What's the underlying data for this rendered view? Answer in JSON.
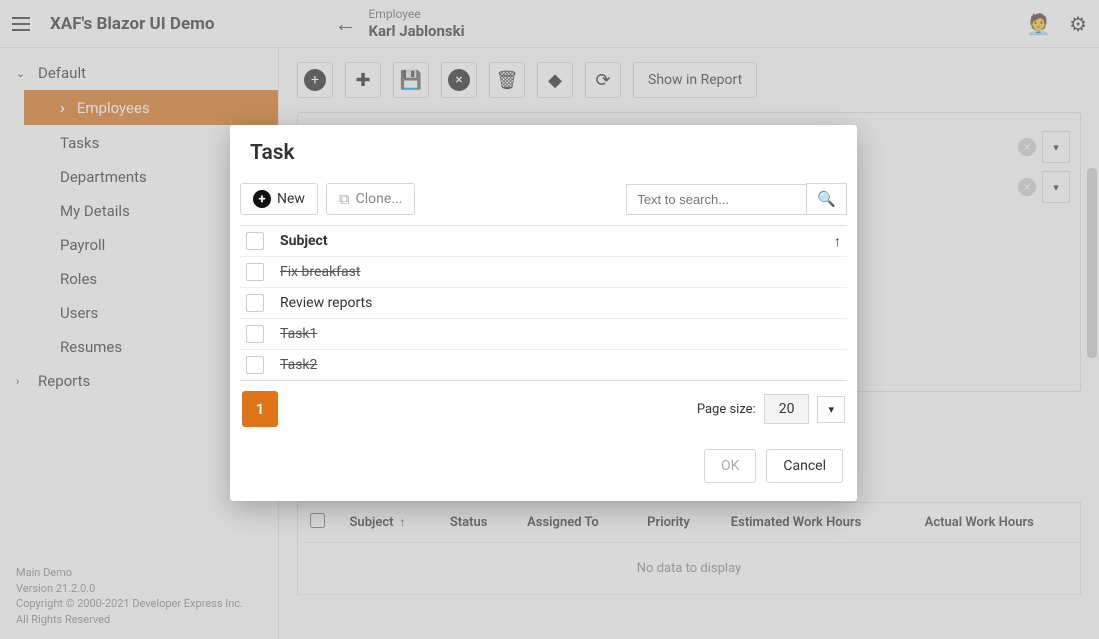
{
  "header": {
    "app_title": "XAF's Blazor UI Demo",
    "crumb": "Employee",
    "name": "Karl Jablonski"
  },
  "sidebar": {
    "root": "Default",
    "items": [
      "Employees",
      "Tasks",
      "Departments",
      "My Details",
      "Payroll",
      "Roles",
      "Users",
      "Resumes"
    ],
    "reports": "Reports",
    "footer": {
      "l1": "Main Demo",
      "l2": "Version 21.2.0.0",
      "l3": "Copyright © 2000-2021 Developer Express Inc.",
      "l4": "All Rights Reserved"
    }
  },
  "toolbar": {
    "show_in_report": "Show in Report"
  },
  "dialog": {
    "title": "Task",
    "new_label": "New",
    "clone_label": "Clone...",
    "search_placeholder": "Text to search...",
    "col_subject": "Subject",
    "rows": [
      {
        "subject": "Fix breakfast",
        "struck": true
      },
      {
        "subject": "Review reports",
        "struck": false
      },
      {
        "subject": "Task1",
        "struck": true
      },
      {
        "subject": "Task2",
        "struck": true
      }
    ],
    "pager": {
      "page": "1",
      "page_size_label": "Page size:",
      "page_size": "20"
    },
    "ok": "OK",
    "cancel": "Cancel"
  },
  "child_grid": {
    "cols": [
      "Subject",
      "Status",
      "Assigned To",
      "Priority",
      "Estimated Work Hours",
      "Actual Work Hours"
    ],
    "no_data": "No data to display"
  }
}
